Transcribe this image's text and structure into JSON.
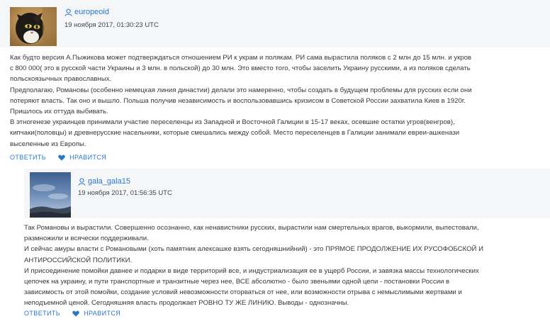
{
  "comments": [
    {
      "username": "europeoid",
      "timestamp": "19 ноября 2017, 01:30:23 UTC",
      "lines": [
        "Как будто версия А.Пыжикова может подтверждаться отношением РИ к украм и полякам. РИ сама вырастила поляков с 2 млн до 15 млн. и укров",
        "с 800 000( это в русской части Украины и 3 млн. в польской) до 30 млн. Это вместо того, чтобы заселить Украину русскими, а из поляков сделать",
        "польскоязычных православных.",
        "Предполагаю, Романовы (особенно немецкая линия династии) делали это намеренно, чтобы создать в будущем проблемы для русских если они",
        "потеряют власть. Так оно и вышло. Польша получив независимость и воспользовавшись кризисом в Советской России захватила Киев в 1920г.",
        "Пришлось их оттуда выбивать.",
        "В этногенезе украинцев принимали участие переселенцы из Западной и Восточной Галиции в 15-17 веках, осевшие остатки угров(венгров),",
        "кипчаки(половцы) и древнерусские насельники, которые смешались между собой. Место переселенцев в Галиции занимали евреи-ашкенази",
        "выселенные из Европы."
      ],
      "reply_label": "ОТВЕТИТЬ",
      "like_label": "НРАВИТСЯ"
    },
    {
      "username": "gala_gala15",
      "timestamp": "19 ноября 2017, 01:56:35 UTC",
      "lines": [
        "Так Романовы и вырастили. Совершенно осознанно, как ненавистники русских, вырастили нам смертельных врагов, выкормили, выпестовали,",
        "размножили и всячески поддерживали.",
        "И сейчас амуры власти с Романовыми (хоть памятник алексашке взять сегодняшнийний) - это ПРЯМОЕ ПРОДОЛЖЕНИЕ ИХ РУСОФОБСКОЙ И",
        "АНТИРОССИЙСКОЙ ПОЛИТИКИ.",
        "И присоединение помойки давнее и подарки в виде территорий все, и индустриализация ее в ущерб России, и завязка массы технологических",
        "цепочек на украину, и пути транспортные и транзитные через нее, ВСЕ абсолютно - было звеньями одной цепи - постановки России в",
        "зависимость от этой помойки, создание условий невозможности оторваться от нее, или возможности отрыва с немыслимыми жертвами и",
        "неподъемной ценой. Сегодняшняя власть продолжает РОВНО ТУ ЖЕ ЛИНИЮ. Выводы - однозначны."
      ],
      "reply_label": "ОТВЕТИТЬ",
      "like_label": "НРАВИТСЯ"
    }
  ],
  "colors": {
    "link": "#2a77c8",
    "header_bg": "#f5f6f8",
    "text": "#383838"
  },
  "icons": {
    "user": "user-icon",
    "like": "heart-icon",
    "avatar_1": "cat-photo",
    "avatar_2": "sky-photo"
  }
}
